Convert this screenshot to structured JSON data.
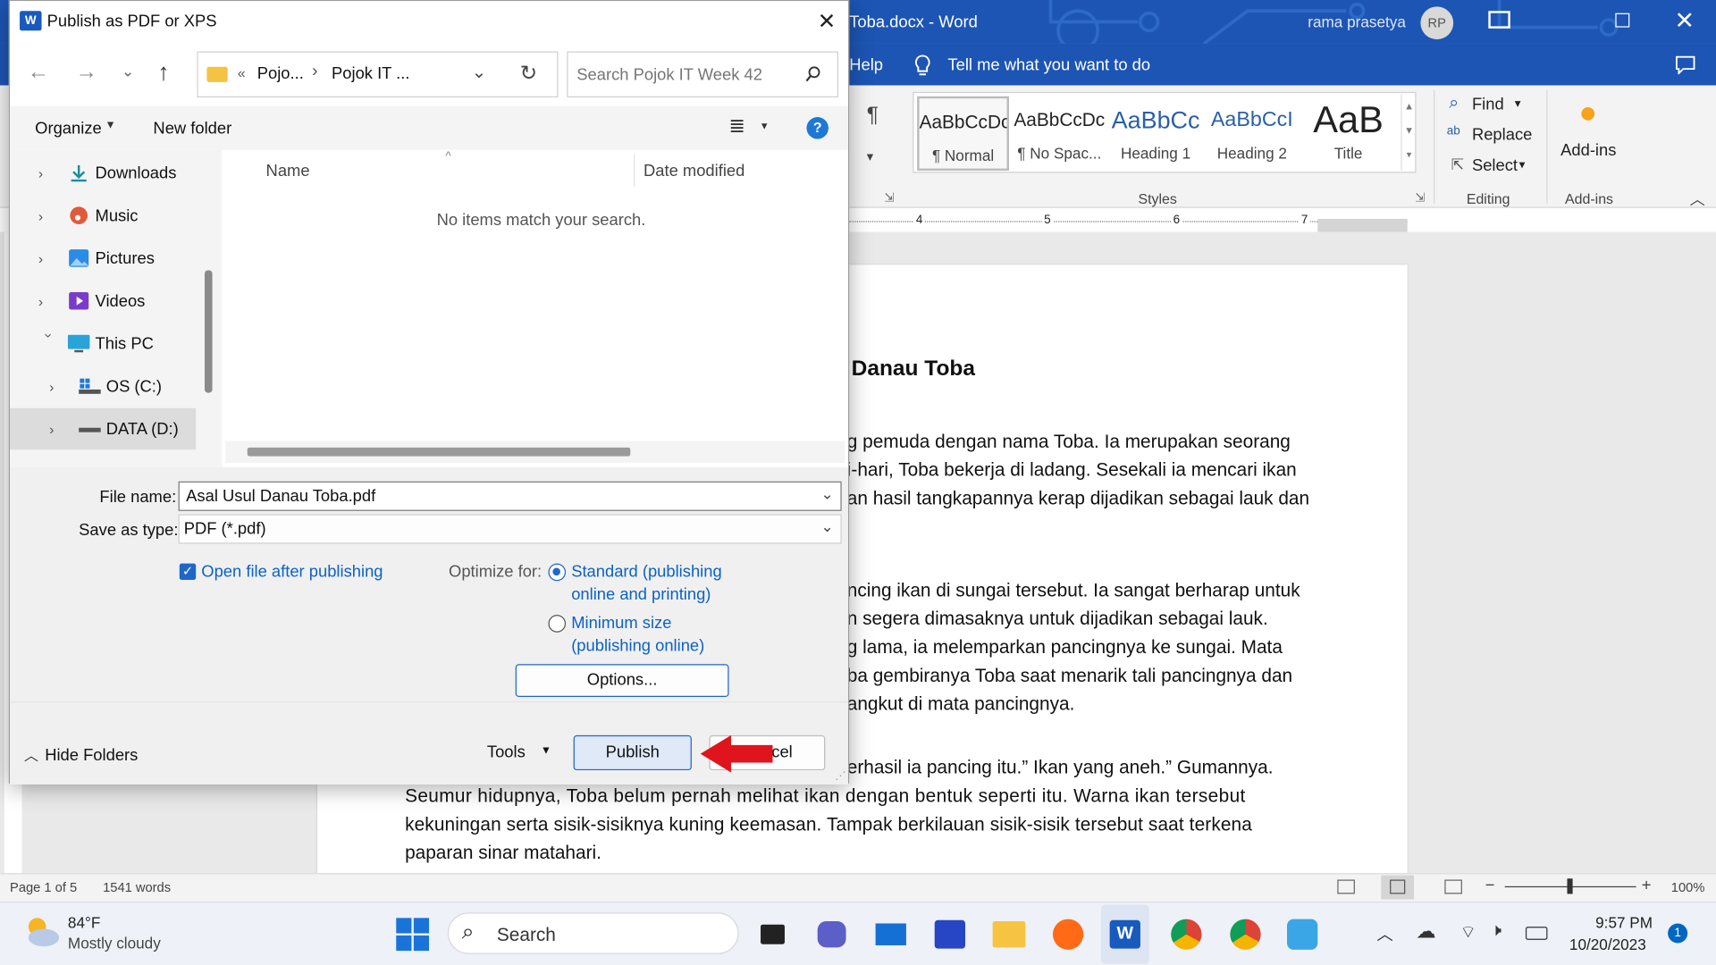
{
  "word": {
    "title": "Toba.docx  -  Word",
    "user": "rama prasetya",
    "user_initials": "RP",
    "help_tab": "Help",
    "tell_me": "Tell me what you want to do",
    "styles": [
      {
        "sample": "AaBbCcDc",
        "name": "¶ Normal"
      },
      {
        "sample": "AaBbCcDc",
        "name": "¶ No Spac..."
      },
      {
        "sample": "AaBbCc",
        "name": "Heading 1"
      },
      {
        "sample": "AaBbCcI",
        "name": "Heading 2"
      },
      {
        "sample": "AaB",
        "name": "Title"
      }
    ],
    "styles_label": "Styles",
    "editing": {
      "find": "Find",
      "replace": "Replace",
      "select": "Select",
      "label": "Editing"
    },
    "addins": {
      "button": "Add-ins",
      "label": "Add-ins"
    },
    "ruler_marks": [
      "4",
      "5",
      "6",
      "7"
    ],
    "doc": {
      "heading": "Danau Toba",
      "lines": [
        "g pemuda dengan nama Toba. Ia merupakan seorang",
        "i-hari, Toba bekerja di ladang. Sesekali ia mencari ikan",
        "an hasil tangkapannya kerap dijadikan sebagai lauk dan",
        "ncing ikan di sungai tersebut. Ia sangat berharap untuk",
        "n segera dimasaknya untuk dijadikan sebagai lauk.",
        "g lama, ia melemparkan pancingnya ke sungai. Mata",
        "ba gembiranya Toba saat menarik tali pancingnya dan",
        "angkut di mata pancingnya.",
        "erhasil ia pancing itu.” Ikan yang aneh.” Gumannya.",
        "Seumur hidupnya, Toba belum pernah melihat ikan dengan bentuk seperti itu. Warna ikan tersebut",
        "kekuningan serta sisik-sisiknya kuning keemasan. Tampak berkilauan sisik-sisik tersebut saat terkena",
        "paparan sinar matahari."
      ]
    },
    "status": {
      "page": "Page 1 of 5",
      "words": "1541 words",
      "zoom": "100%"
    }
  },
  "dialog": {
    "title": "Publish as PDF or XPS",
    "breadcrumb": [
      "Pojo...",
      "Pojok IT ..."
    ],
    "breadcrumb_overflow": "«",
    "search_placeholder": "Search Pojok IT Week 42",
    "organize": "Organize",
    "new_folder": "New folder",
    "tree": [
      {
        "label": "Downloads",
        "icon": "download-icon",
        "expanded": false
      },
      {
        "label": "Music",
        "icon": "music-icon",
        "expanded": false
      },
      {
        "label": "Pictures",
        "icon": "pictures-icon",
        "expanded": false
      },
      {
        "label": "Videos",
        "icon": "videos-icon",
        "expanded": false
      },
      {
        "label": "This PC",
        "icon": "pc-icon",
        "expanded": true
      },
      {
        "label": "OS (C:)",
        "icon": "drive-icon",
        "expanded": false
      },
      {
        "label": "DATA (D:)",
        "icon": "drive-icon",
        "expanded": false,
        "selected": true
      }
    ],
    "columns": {
      "name": "Name",
      "date": "Date modified"
    },
    "empty_message": "No items match your search.",
    "file_name_label": "File name:",
    "file_name_value": "Asal Usul Danau Toba.pdf",
    "save_type_label": "Save as type:",
    "save_type_value": "PDF (*.pdf)",
    "open_after": "Open file after publishing",
    "open_after_checked": true,
    "optimize_label": "Optimize for:",
    "optimize_standard": [
      "Standard (publishing",
      "online and printing)"
    ],
    "optimize_minimum": [
      "Minimum size",
      "(publishing online)"
    ],
    "optimize_selected": "standard",
    "options_button": "Options...",
    "hide_folders": "Hide Folders",
    "tools": "Tools",
    "publish": "Publish",
    "cancel_partial": "cel"
  },
  "taskbar": {
    "weather_temp": "84°F",
    "weather_desc": "Mostly cloudy",
    "search": "Search",
    "time": "9:57 PM",
    "date": "10/20/2023",
    "notification_count": "1"
  },
  "colors": {
    "word_blue": "#1d55b4",
    "accent": "#0b62c5",
    "annotation_arrow": "#e0141c"
  }
}
